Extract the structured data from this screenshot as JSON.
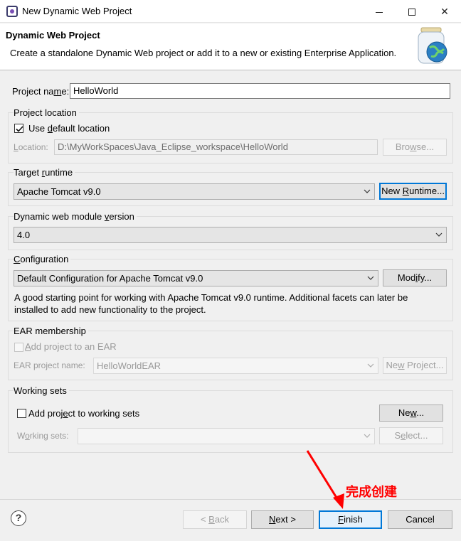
{
  "window": {
    "title": "New Dynamic Web Project",
    "controls": {
      "minimize": "–",
      "maximize": "□",
      "close": "✕"
    }
  },
  "header": {
    "title": "Dynamic Web Project",
    "description": "Create a standalone Dynamic Web project or add it to a new or existing Enterprise Application."
  },
  "project_name": {
    "label_pre": "Project na",
    "label_ul": "m",
    "label_post": "e:",
    "value": "HelloWorld"
  },
  "project_location": {
    "group_title": "Project location",
    "use_default": {
      "label_pre": "Use ",
      "label_ul": "d",
      "label_post": "efault location",
      "checked": true
    },
    "location_label_ul": "L",
    "location_label_post": "ocation:",
    "location_value": "D:\\MyWorkSpaces\\Java_Eclipse_workspace\\HelloWorld",
    "browse_pre": "Bro",
    "browse_ul": "w",
    "browse_post": "se..."
  },
  "target_runtime": {
    "group_title_pre": "Target ",
    "group_title_ul": "r",
    "group_title_post": "untime",
    "selected": "Apache Tomcat v9.0",
    "new_runtime_pre": "New ",
    "new_runtime_ul": "R",
    "new_runtime_post": "untime..."
  },
  "module_version": {
    "group_title_pre": "Dynamic web module ",
    "group_title_ul": "v",
    "group_title_post": "ersion",
    "selected": "4.0"
  },
  "configuration": {
    "group_title_ul": "C",
    "group_title_post": "onfiguration",
    "selected": "Default Configuration for Apache Tomcat v9.0",
    "modify_pre": "Mod",
    "modify_ul": "i",
    "modify_post": "fy...",
    "description_line1": "A good starting point for working with Apache Tomcat v9.0 runtime. Additional facets can later be",
    "description_line2": "installed to add new functionality to the project."
  },
  "ear_membership": {
    "group_title": "EAR membership",
    "add_label_ul": "A",
    "add_label_post": "dd project to an EAR",
    "add_checked": false,
    "ear_name_label_pre": "EAR pro",
    "ear_name_label_ul": "j",
    "ear_name_label_post": "ect name:",
    "ear_name_value": "HelloWorldEAR",
    "new_project_pre": "Ne",
    "new_project_ul": "w",
    "new_project_post": " Project..."
  },
  "working_sets": {
    "group_title": "Working sets",
    "add_label_pre": "Add proj",
    "add_label_ul": "e",
    "add_label_post": "ct to working sets",
    "add_checked": false,
    "new_pre": "Ne",
    "new_ul": "w",
    "new_post": "...",
    "sets_label_pre": "W",
    "sets_label_ul": "o",
    "sets_label_post": "rking sets:",
    "sets_value": "",
    "select_pre": "S",
    "select_ul": "e",
    "select_post": "lect..."
  },
  "footer": {
    "help": "?",
    "back_pre": "< ",
    "back_ul": "B",
    "back_post": "ack",
    "next_ul": "N",
    "next_post": "ext >",
    "finish_ul": "F",
    "finish_post": "inish",
    "cancel": "Cancel"
  },
  "annotation": {
    "text": "完成创建",
    "color": "#ff0000"
  },
  "colors": {
    "accent": "#0078d7",
    "annotation": "#ff0000"
  }
}
